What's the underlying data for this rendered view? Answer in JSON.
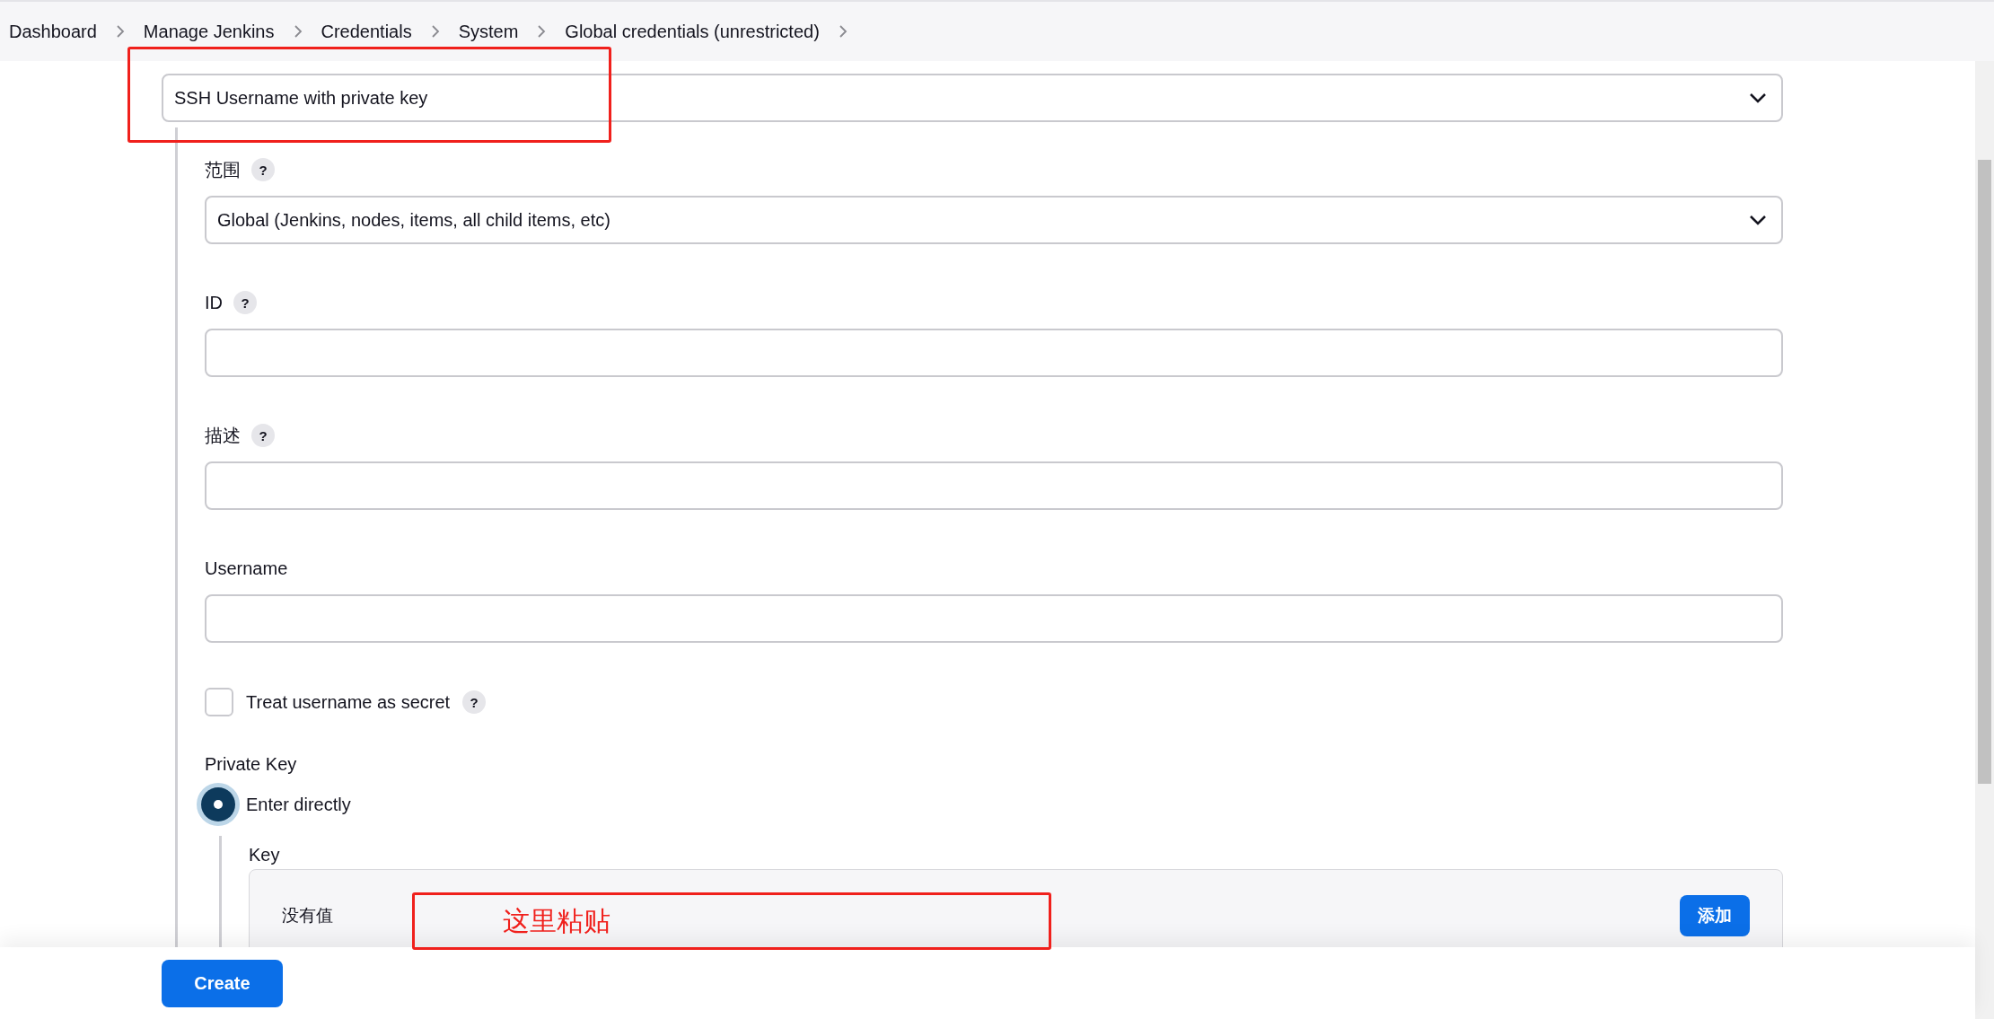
{
  "breadcrumbs": [
    {
      "label": "Dashboard"
    },
    {
      "label": "Manage Jenkins"
    },
    {
      "label": "Credentials"
    },
    {
      "label": "System"
    },
    {
      "label": "Global credentials (unrestricted)"
    }
  ],
  "credential_kind": {
    "value": "SSH Username with private key"
  },
  "fields": [
    {
      "kind": "select",
      "label": "范围",
      "help": "?",
      "value": "Global (Jenkins, nodes, items, all child items, etc)"
    },
    {
      "kind": "text",
      "label": "ID",
      "help": "?"
    },
    {
      "kind": "text",
      "label": "描述",
      "help": "?"
    },
    {
      "kind": "text",
      "label": "Username"
    }
  ],
  "treat_username_secret": {
    "label": "Treat username as secret",
    "checked": false,
    "help": "?"
  },
  "private_key": {
    "label": "Private Key",
    "options": [
      {
        "label": "Enter directly",
        "selected": true
      }
    ],
    "key": {
      "label": "Key",
      "value": "没有值",
      "add_button": "添加"
    }
  },
  "annotation": {
    "note": "这里粘贴"
  },
  "create_button": "Create"
}
